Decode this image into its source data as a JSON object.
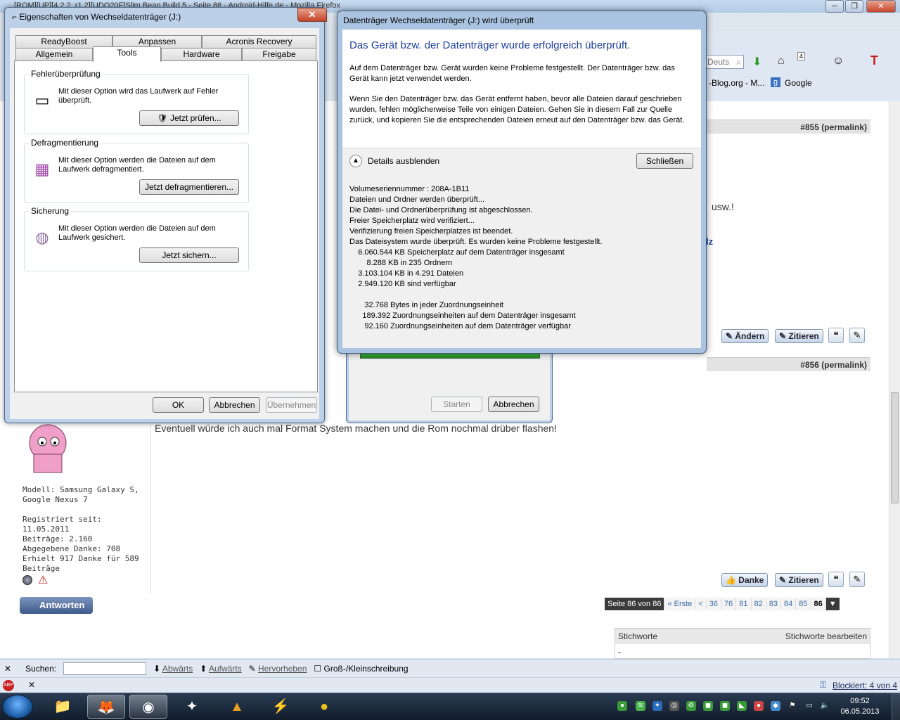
{
  "firefox": {
    "title": "[ROM][UP][4.2.2_r1.2][UDO20F]Slim Bean Build 5 - Seite 86 - Android-Hilfe.de - Mozilla Firefox",
    "search_placeholder": "Deuts",
    "badge_count": "4",
    "bookmarks": [
      "-Blog.org - M...",
      "Google"
    ]
  },
  "forum": {
    "post855": "#855 (permalink)",
    "post856": "#856 (permalink)",
    "snippet_usw": "usw.!",
    "snippet_lz": "lz",
    "body_text": "Eventuell würde ich auch mal Format System machen und die Rom nochmal drüber flashen!",
    "btn_aendern": "Ändern",
    "btn_zitieren": "Zitieren",
    "btn_danke": "Danke",
    "reply": "Antworten",
    "user_info": [
      "Modell: Samsung Galaxy S,",
      "Google Nexus 7",
      "",
      "Registriert seit: 11.05.2011",
      "Beiträge: 2.160",
      "Abgegebene Danke: 708",
      "Erhielt 917 Danke für 589",
      "Beiträge"
    ],
    "pager": {
      "label": "Seite 86 von 86",
      "first": "« Erste",
      "prev": "<",
      "pages": [
        "36",
        "76",
        "81",
        "82",
        "83",
        "84",
        "85",
        "86"
      ]
    },
    "tags": {
      "title": "Stichworte",
      "edit": "Stichworte bearbeiten",
      "value": "-"
    }
  },
  "findbar": {
    "label": "Suchen:",
    "down": "Abwärts",
    "up": "Aufwärts",
    "highlight": "Hervorheben",
    "case": "Groß-/Kleinschreibung"
  },
  "statusbar": {
    "blocked": "Blockiert: 4 von 4"
  },
  "taskbar": {
    "time": "09:52",
    "date": "06.05.2013"
  },
  "props": {
    "title": "Eigenschaften von Wechseldatenträger (J:)",
    "tabs_row1": [
      "ReadyBoost",
      "Anpassen",
      "Acronis Recovery"
    ],
    "tabs_row2": [
      "Allgemein",
      "Tools",
      "Hardware",
      "Freigabe"
    ],
    "groups": [
      {
        "caption": "Fehlerüberprüfung",
        "text": "Mit dieser Option wird das Laufwerk auf Fehler überprüft.",
        "button": "Jetzt prüfen..."
      },
      {
        "caption": "Defragmentierung",
        "text": "Mit dieser Option werden die Dateien auf dem Laufwerk defragmentiert.",
        "button": "Jetzt defragmentieren..."
      },
      {
        "caption": "Sicherung",
        "text": "Mit dieser Option werden die Dateien auf dem Laufwerk gesichert.",
        "button": "Jetzt sichern..."
      }
    ],
    "ok": "OK",
    "cancel": "Abbrechen",
    "apply": "Übernehmen"
  },
  "backdlg": {
    "start": "Starten",
    "cancel": "Abbrechen"
  },
  "check": {
    "title": "Datenträger Wechseldatenträger (J:) wird überprüft",
    "heading": "Das Gerät bzw. der Datenträger wurde erfolgreich überprüft.",
    "p1": "Auf dem Datenträger bzw. Gerät wurden keine Probleme festgestellt. Der Datenträger bzw. das Gerät kann jetzt verwendet werden.",
    "p2": "Wenn Sie den Datenträger bzw. das Gerät entfernt haben, bevor alle Dateien darauf geschrieben wurden, fehlen möglicherweise Teile von einigen Dateien. Gehen Sie in diesem Fall zur Quelle zurück, und kopieren Sie die entsprechenden Dateien erneut auf den Datenträger bzw. das Gerät.",
    "toggle": "Details ausblenden",
    "close": "Schließen",
    "details": "Volumeseriennummer : 208A-1B11\nDateien und Ordner werden überprüft...\nDie Datei- und Ordnerüberprüfung ist abgeschlossen.\nFreier Speicherplatz wird verifiziert...\nVerifizierung freien Speicherplatzes ist beendet.\nDas Dateisystem wurde überprüft. Es wurden keine Probleme festgestellt.\n    6.060.544 KB Speicherplatz auf dem Datenträger insgesamt\n        8.288 KB in 235 Ordnern\n    3.103.104 KB in 4.291 Dateien\n    2.949.120 KB sind verfügbar\n\n       32.768 Bytes in jeder Zuordnungseinheit\n      189.392 Zuordnungseinheiten auf dem Datenträger insgesamt\n       92.160 Zuordnungseinheiten auf dem Datenträger verfügbar"
  }
}
